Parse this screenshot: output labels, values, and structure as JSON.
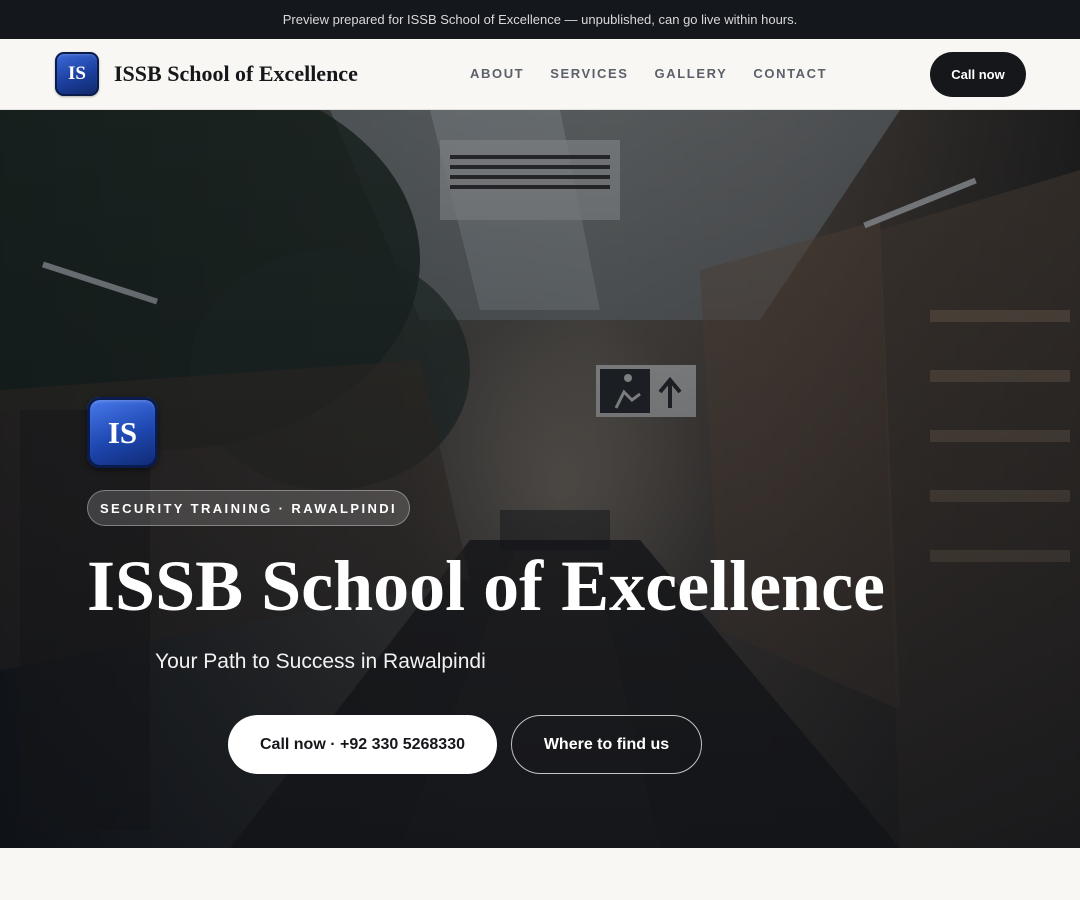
{
  "preview_bar": {
    "text": "Preview prepared for ISSB School of Excellence — unpublished, can go live within hours."
  },
  "header": {
    "logo_initials": "IS",
    "brand_name": "ISSB School of Excellence",
    "nav": [
      {
        "label": "ABOUT"
      },
      {
        "label": "SERVICES"
      },
      {
        "label": "GALLERY"
      },
      {
        "label": "CONTACT"
      }
    ],
    "call_label": "Call now"
  },
  "hero": {
    "badge_initials": "IS",
    "tag": "SECURITY TRAINING · RAWALPINDI",
    "title": "ISSB School of Excellence",
    "subtitle": "Your Path to Success in Rawalpindi",
    "call_button": "Call now · +92 330 5268330",
    "find_button": "Where to find us",
    "exit_sign_icon": "running-man-exit-icon"
  },
  "colors": {
    "preview_bar_bg": "#14171c",
    "header_bg": "#f8f7f3",
    "brand_text": "#15171b",
    "nav_text": "#5b606b",
    "dark_button": "#15171b",
    "logo_blue": "#1b3f9e",
    "hero_text": "#ffffff"
  }
}
